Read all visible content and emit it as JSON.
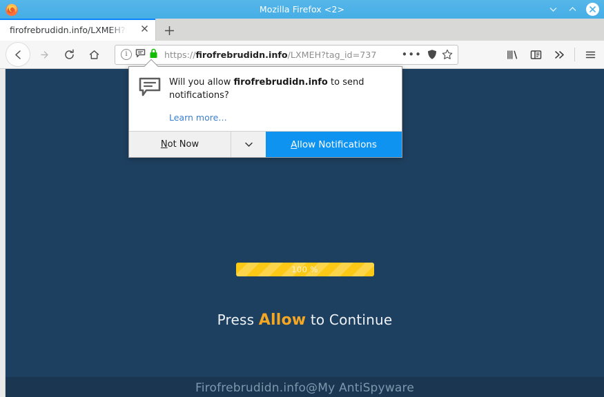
{
  "window": {
    "title": "Mozilla Firefox <2>",
    "minimize_label": "⌄",
    "maximize_label": "⌃",
    "close_label": "✕"
  },
  "tabs": {
    "items": [
      {
        "label": "firofrebrudidn.info/LXMEH?t",
        "close_label": "✕"
      }
    ],
    "new_tab_label": "+"
  },
  "toolbar": {
    "back_label": "←",
    "forward_label": "→",
    "reload_label": "⟳",
    "home_label": "⌂",
    "info_label": "i",
    "url": {
      "scheme": "https://",
      "host": "firofrebrudidn.info",
      "path": "/LXMEH?tag_id=737"
    },
    "page_actions_label": "•••",
    "library_label": "library",
    "sidebar_label": "sidebar",
    "overflow_label": "»",
    "menu_label": "≡"
  },
  "popup": {
    "question_prefix": "Will you allow ",
    "question_host": "firofrebrudidn.info",
    "question_suffix": " to send notifications?",
    "learn_more": "Learn more…",
    "not_now_accel": "N",
    "not_now_rest": "ot Now",
    "chevron_label": "⌄",
    "allow_accel": "A",
    "allow_rest": "llow Notifications"
  },
  "page": {
    "progress_percent": "100 %",
    "progress_value": 100,
    "press_prefix": "Press ",
    "press_highlight": "Allow",
    "press_suffix": " to Continue",
    "watermark": "Firofrebrudidn.info@My AntiSpyware",
    "background_color": "#1e4060",
    "accent_color": "#f5a623",
    "progress_color": "#fcc917"
  }
}
